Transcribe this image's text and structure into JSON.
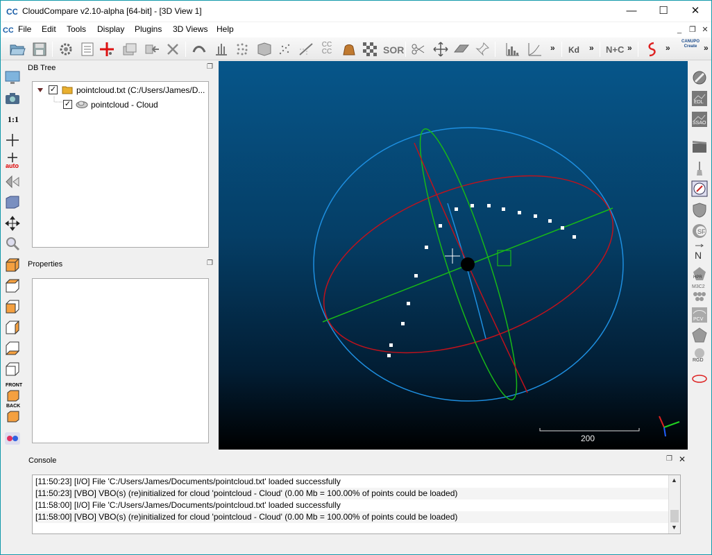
{
  "window": {
    "title": "CloudCompare v2.10-alpha [64-bit] - [3D View 1]",
    "minimize": "—",
    "maximize": "☐",
    "close": "✕"
  },
  "menu": {
    "items": [
      "File",
      "Edit",
      "Tools",
      "Display",
      "Plugins",
      "3D Views",
      "Help"
    ]
  },
  "toolbar": {
    "more": "»",
    "labels": {
      "cccc": "CC CC",
      "sor": "SOR",
      "kd": "Kd",
      "nc": "N+C",
      "canupo": "CANUPO Create"
    }
  },
  "left_toolbar": {
    "one_to_one": "1:1",
    "auto": "auto",
    "front": "FRONT",
    "back": "BACK"
  },
  "right_toolbar": {
    "edl": "EDL",
    "ssao": "SSAO",
    "north": "N",
    "hpr": "HPR",
    "m3c2": "M3C2",
    "pcv": "PCV",
    "rgd": "RGD"
  },
  "db_tree": {
    "title": "DB Tree",
    "items": [
      {
        "label": "pointcloud.txt (C:/Users/James/D...",
        "checked": true
      },
      {
        "label": "pointcloud - Cloud",
        "checked": true
      }
    ]
  },
  "properties": {
    "title": "Properties"
  },
  "view3d": {
    "scale_label": "200"
  },
  "console": {
    "title": "Console",
    "lines": [
      "[11:50:23] [I/O] File 'C:/Users/James/Documents/pointcloud.txt' loaded successfully",
      "[11:50:23] [VBO] VBO(s) (re)initialized for cloud 'pointcloud - Cloud' (0.00 Mb = 100.00% of points could be loaded)",
      "[11:58:00] [I/O] File 'C:/Users/James/Documents/pointcloud.txt' loaded successfully",
      "[11:58:00] [VBO] VBO(s) (re)initialized for cloud 'pointcloud - Cloud' (0.00 Mb = 100.00% of points could be loaded)"
    ]
  },
  "colors": {
    "view_top": "#06568a",
    "view_bottom": "#000000",
    "sphere_blue": "#1e8fe0",
    "ellipse_red": "#c0121c",
    "ellipse_green": "#18b818"
  }
}
